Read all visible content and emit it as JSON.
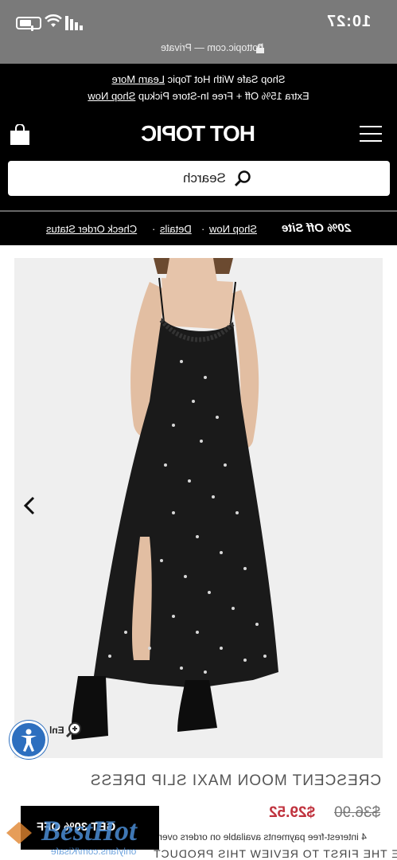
{
  "status_bar": {
    "time": "10:27",
    "url": "hottopic.com — Private"
  },
  "promo_bar": {
    "line1_text": "Shop Safe With Hot Topic ",
    "line1_link": "Learn More",
    "line2_text": "Extra 15% Off + Free In-Store Pickup ",
    "line2_link": "Shop Now"
  },
  "header": {
    "logo": "HOT TOPIC",
    "search_placeholder": "Search"
  },
  "discount_bar": {
    "headline": "20% Off Site",
    "links": [
      "Shop Now",
      "Details",
      "Check Order Status"
    ]
  },
  "product": {
    "name": "CRESCENT MOON MAXI SLIP DRESS",
    "price_sale": "$29.52",
    "price_original": "$36.90",
    "installments": "4 interest-free payments available on orders over",
    "review_prompt": "BE THE FIRST TO REVIEW THIS PRODUCT",
    "zoom_label": "Enl",
    "promo_box": "GET 30% OFF"
  },
  "watermark": {
    "brand": "BestHot",
    "sub": "onlyfans.com/Kisafe"
  }
}
